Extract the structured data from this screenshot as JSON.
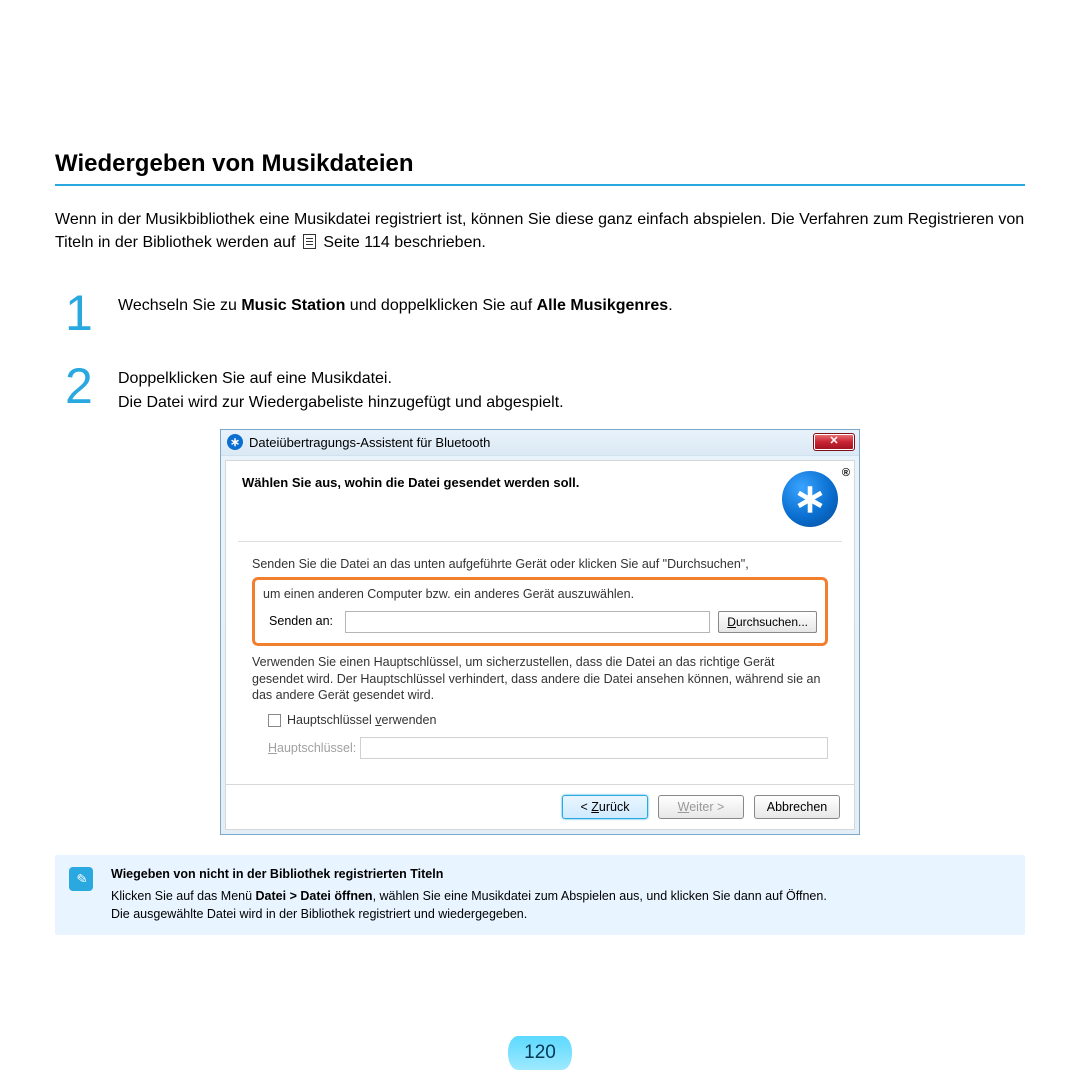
{
  "section_title": "Wiedergeben von Musikdateien",
  "intro_part1": "Wenn in der Musikbibliothek eine Musikdatei registriert ist, können Sie diese ganz einfach abspielen. Die Verfahren zum Registrieren von Titeln in der Bibliothek werden auf ",
  "intro_part2": " Seite 114 beschrieben.",
  "steps": {
    "1": {
      "num": "1",
      "text_pre": "Wechseln Sie zu ",
      "bold1": "Music Station",
      "text_mid": " und doppelklicken Sie auf ",
      "bold2": "Alle Musikgenres",
      "text_post": "."
    },
    "2": {
      "num": "2",
      "line1": "Doppelklicken Sie auf eine Musikdatei.",
      "line2": "Die Datei wird zur Wiedergabeliste hinzugefügt und abgespielt."
    }
  },
  "dialog": {
    "title": "Dateiübertragungs-Assistent für Bluetooth",
    "heading": "Wählen Sie aus, wohin die Datei gesendet werden soll.",
    "bt_glyph": "∗",
    "instruction1": "Senden Sie die Datei an das unten aufgeführte Gerät oder klicken Sie auf \"Durchsuchen\",",
    "instruction2": "um einen anderen Computer bzw. ein anderes Gerät auszuwählen.",
    "send_label": "Senden an:",
    "browse": "Durchsuchen...",
    "key_para": "Verwenden Sie einen Hauptschlüssel, um sicherzustellen, dass die Datei an das richtige Gerät gesendet wird. Der Hauptschlüssel verhindert, dass andere die Datei ansehen können, während sie an das andere Gerät gesendet wird.",
    "use_key": "Hauptschlüssel verwenden",
    "key_label": "Hauptschlüssel:",
    "back": "< Zurück",
    "next": "Weiter >",
    "cancel": "Abbrechen"
  },
  "note": {
    "title": "Wiegeben von nicht in der Bibliothek registrierten Titeln",
    "line1_pre": "Klicken Sie auf das Menü ",
    "line1_bold": "Datei > Datei öffnen",
    "line1_post": ", wählen Sie eine Musikdatei zum Abspielen aus, und klicken Sie dann auf Öffnen.",
    "line2": "Die ausgewählte Datei wird in der Bibliothek registriert und wiedergegeben."
  },
  "page_number": "120"
}
